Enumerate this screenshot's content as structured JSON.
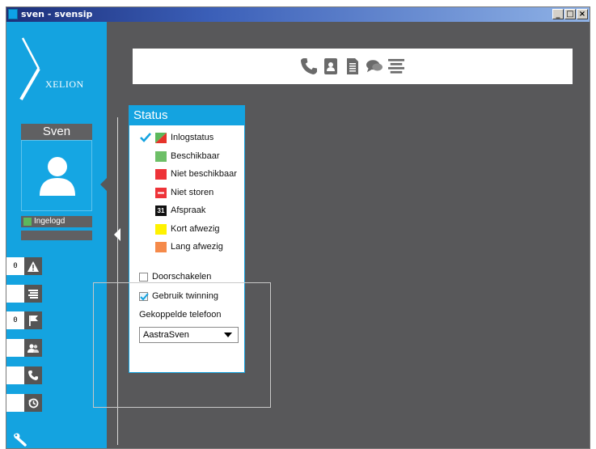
{
  "window": {
    "title": "sven - svensip",
    "controls": [
      "_",
      "□",
      "×"
    ]
  },
  "logo": {
    "text": "XELION"
  },
  "user": {
    "name": "Sven",
    "status_label": "Ingelogd",
    "status_color": "#5cb85c"
  },
  "nav": [
    {
      "count": "0",
      "icon": "warning-icon"
    },
    {
      "count": "",
      "icon": "list-icon"
    },
    {
      "count": "0",
      "icon": "flag-icon"
    },
    {
      "count": "",
      "icon": "contacts-icon"
    },
    {
      "count": "",
      "icon": "phone-icon"
    },
    {
      "count": "",
      "icon": "history-icon"
    }
  ],
  "toolbar": [
    "phone-icon",
    "address-book-icon",
    "document-icon",
    "chat-icon",
    "menu-icon"
  ],
  "panel": {
    "title": "Status",
    "statuses": [
      {
        "label": "Inlogstatus",
        "color": "#e6332a",
        "color2": "#5cb85c",
        "checked": true
      },
      {
        "label": "Beschikbaar",
        "color": "#6dbf67"
      },
      {
        "label": "Niet beschikbaar",
        "color": "#ee3338"
      },
      {
        "label": "Niet storen",
        "color": "#ee3338"
      },
      {
        "label": "Afspraak",
        "color": "#111111",
        "badge": "31"
      },
      {
        "label": "Kort afwezig",
        "color": "#fff200"
      },
      {
        "label": "Lang afwezig",
        "color": "#f58a4a"
      }
    ],
    "forward_label": "Doorschakelen",
    "twinning_label": "Gebruik twinning",
    "linked_phone_label": "Gekoppelde telefoon",
    "linked_phone_value": "AastraSven"
  }
}
